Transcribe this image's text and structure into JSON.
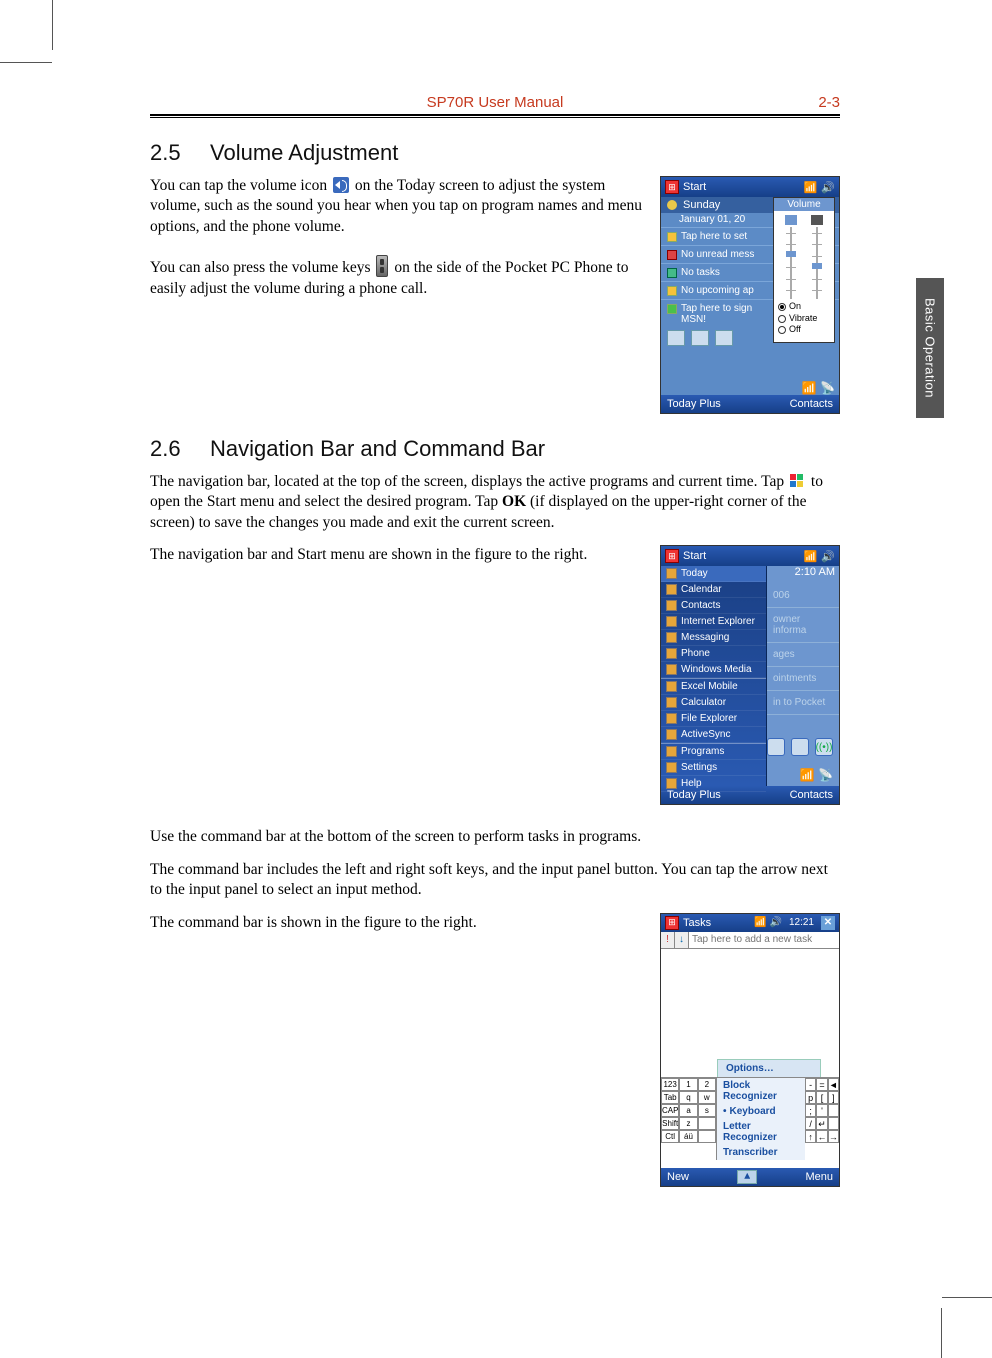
{
  "header": {
    "title": "SP70R User Manual",
    "page": "2-3"
  },
  "sidebar_tab": "Basic Operation",
  "section25": {
    "num": "2.5",
    "title": "Volume Adjustment",
    "p1a": "You can tap the volume icon ",
    "p1b": " on the Today screen to adjust the system volume, such as the sound you hear when you tap on program names and menu options, and the phone volume.",
    "p2a": "You can also press the volume keys ",
    "p2b": " on the side of the Pocket PC Phone to easily adjust the volume during a phone call."
  },
  "section26": {
    "num": "2.6",
    "title": "Navigation Bar and Command Bar",
    "p1a": "The navigation bar, located at the top of the screen, displays the active programs and current time. Tap ",
    "p1b": " to open the Start menu and select the desired program. Tap ",
    "ok": "OK",
    "p1c": " (if displayed on the upper-right corner of the screen) to save the changes you made and exit the current screen.",
    "p2": "The navigation bar and Start menu are shown in the figure to the right.",
    "p3": "Use the command bar at the bottom of the screen to perform tasks in programs.",
    "p4": "The command bar includes the left and right soft keys, and the input panel button. You can tap the arrow next to the input panel to select an input method.",
    "p5": "The command bar is shown in the figure to the right."
  },
  "fig1": {
    "start": "Start",
    "day": "Sunday",
    "date": "January 01, 20",
    "vol_hdr": "Volume",
    "rows": {
      "owner": "Tap here to set",
      "msg": "No unread mess",
      "tasks": "No tasks",
      "appt": "No upcoming ap",
      "msn": "Tap here to sign",
      "msn2": "MSN!"
    },
    "radios": {
      "on": "On",
      "vibrate": "Vibrate",
      "off": "Off"
    },
    "left_soft": "Today Plus",
    "right_soft": "Contacts"
  },
  "fig2": {
    "start": "Start",
    "time": "2:10 AM",
    "menu": [
      "Today",
      "Calendar",
      "Contacts",
      "Internet Explorer",
      "Messaging",
      "Phone",
      "Windows Media",
      "Excel Mobile",
      "Calculator",
      "File Explorer",
      "ActiveSync",
      "Programs",
      "Settings",
      "Help"
    ],
    "rrows": [
      "006",
      "owner informa",
      "ages",
      "ointments",
      "in to Pocket"
    ],
    "left_soft": "Today Plus",
    "right_soft": "Contacts"
  },
  "fig3": {
    "title": "Tasks",
    "time": "12:21",
    "close": "✕",
    "sort1": "!",
    "sort2": "↓",
    "placeholder": "Tap here to add a new task",
    "options": "Options…",
    "kb": [
      [
        "123",
        "1",
        "2"
      ],
      [
        "Tab",
        "q",
        "w"
      ],
      [
        "CAP",
        "a",
        "s"
      ],
      [
        "Shift",
        "z",
        ""
      ],
      [
        "Ctl",
        "áü",
        ""
      ]
    ],
    "sip": [
      "Block Recognizer",
      "Keyboard",
      "Letter Recognizer",
      "Transcriber"
    ],
    "sip_selected": "Keyboard",
    "arrows": [
      [
        "-",
        "=",
        "◄"
      ],
      [
        "p",
        "[",
        "]"
      ],
      [
        ";",
        "'",
        ""
      ],
      [
        "/",
        "↵",
        ""
      ],
      [
        "↑",
        "←",
        "→"
      ]
    ],
    "left_soft": "New",
    "right_soft": "Menu"
  }
}
